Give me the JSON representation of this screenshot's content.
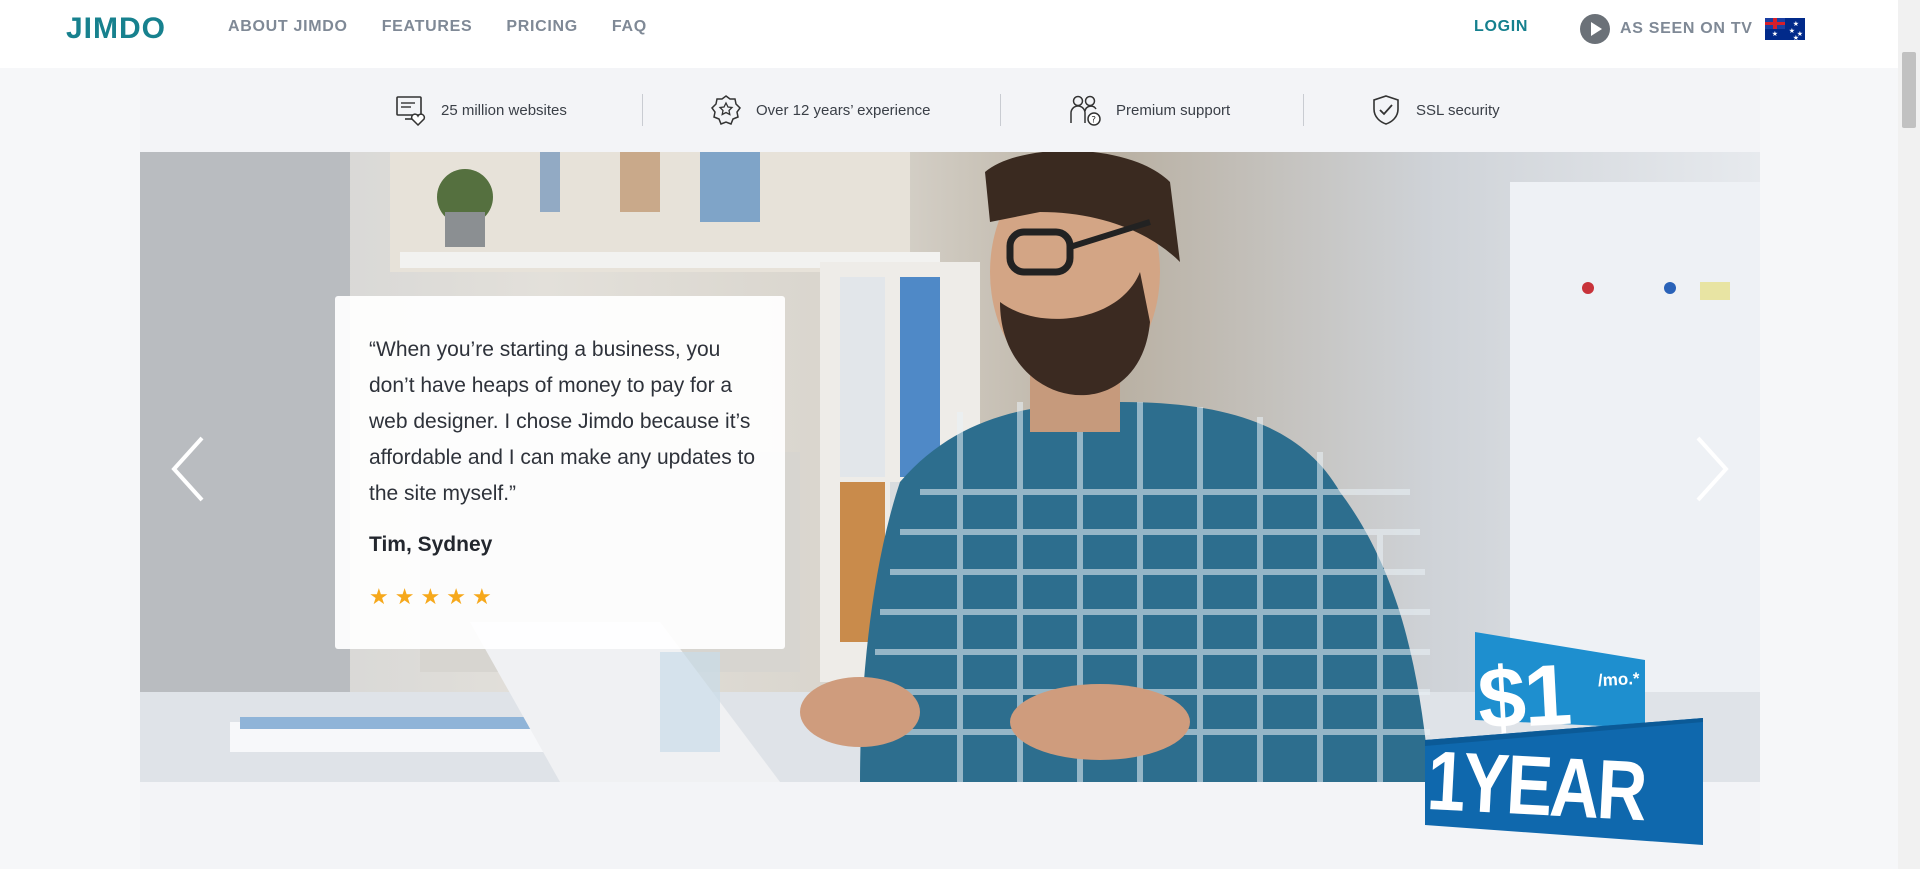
{
  "header": {
    "logo": "JIMDO",
    "nav": [
      "ABOUT JIMDO",
      "FEATURES",
      "PRICING",
      "FAQ"
    ],
    "login": "LOGIN",
    "tv_label": "AS SEEN ON TV",
    "icons": {
      "play": "play-icon",
      "flag": "australia-flag-icon"
    }
  },
  "trust_bar": [
    {
      "icon": "monitor-heart-icon",
      "label": "25 million websites"
    },
    {
      "icon": "award-ribbon-icon",
      "label": "Over 12 years’ experience"
    },
    {
      "icon": "support-people-icon",
      "label": "Premium support"
    },
    {
      "icon": "shield-check-icon",
      "label": "SSL security"
    }
  ],
  "testimonial": {
    "quote": "“When you’re starting a business, you don’t have heaps of money to pay for a web designer. I chose Jimdo because it’s affordable and I can make any updates to the site myself.”",
    "author": "Tim, Sydney",
    "rating": 5
  },
  "carousel": {
    "prev_icon": "chevron-left-icon",
    "next_icon": "chevron-right-icon"
  },
  "promo": {
    "price": "$1",
    "unit": "/mo.*",
    "duration": "1YEAR"
  },
  "colors": {
    "brand_teal": "#17818e",
    "nav_gray": "#7f8996",
    "star_orange": "#f6a81b",
    "promo_blue": "#1e8fcf",
    "promo_dark_blue": "#0f68ad"
  }
}
